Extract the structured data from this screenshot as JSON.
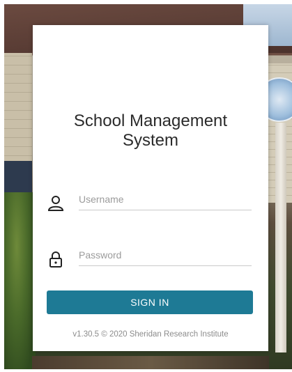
{
  "app": {
    "title_line1": "School Management",
    "title_line2": "System"
  },
  "login": {
    "username_placeholder": "Username",
    "password_placeholder": "Password",
    "username_icon": "user-icon",
    "password_icon": "lock-icon",
    "signin_label": "SIGN IN"
  },
  "footer": {
    "text": "v1.30.5 © 2020 Sheridan Research Institute"
  },
  "colors": {
    "accent": "#1e7a95",
    "card": "#ffffff",
    "text": "#2b2b2b"
  }
}
